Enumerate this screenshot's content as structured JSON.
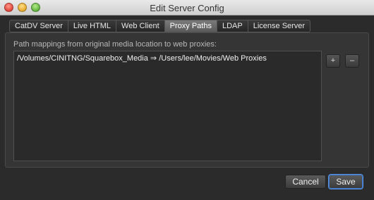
{
  "window": {
    "title": "Edit Server Config"
  },
  "tabs": [
    {
      "label": "CatDV Server"
    },
    {
      "label": "Live HTML"
    },
    {
      "label": "Web Client"
    },
    {
      "label": "Proxy Paths",
      "active": true
    },
    {
      "label": "LDAP"
    },
    {
      "label": "License Server"
    }
  ],
  "proxy_paths": {
    "label": "Path mappings from original media location to web proxies:",
    "mappings": [
      {
        "text": "/Volumes/CINITNG/Squarebox_Media ⇒ /Users/lee/Movies/Web Proxies"
      }
    ],
    "add_label": "+",
    "remove_label": "–"
  },
  "footer": {
    "cancel_label": "Cancel",
    "save_label": "Save"
  },
  "colors": {
    "focus_ring": "#3d76c9"
  }
}
